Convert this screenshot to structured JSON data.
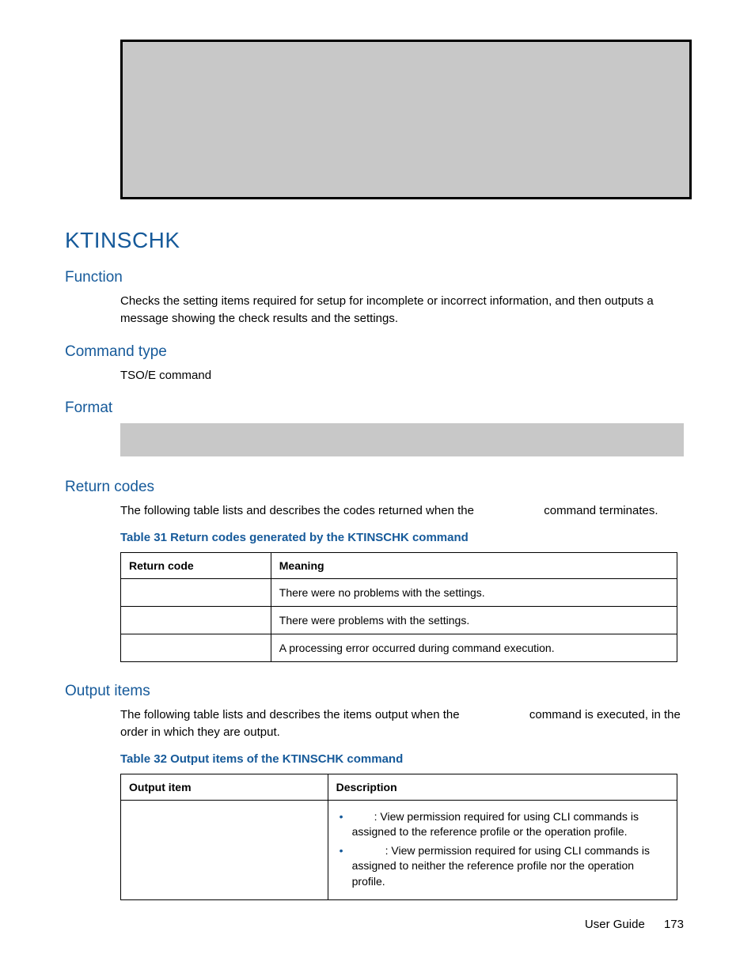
{
  "command_name": "KTINSCHK",
  "sections": {
    "function": {
      "title": "Function",
      "text": "Checks the setting items required for setup for incomplete or incorrect information, and then outputs a message showing the check results and the settings."
    },
    "command_type": {
      "title": "Command type",
      "text": "TSO/E command"
    },
    "format": {
      "title": "Format"
    },
    "return_codes": {
      "title": "Return codes",
      "intro_before": "The following table lists and describes the codes returned when the ",
      "intro_after": " command terminates.",
      "caption": "Table 31 Return codes generated by the KTINSCHK command",
      "headers": [
        "Return code",
        "Meaning"
      ],
      "rows": [
        {
          "code": "",
          "meaning": "There were no problems with the settings."
        },
        {
          "code": "",
          "meaning": "There were problems with the settings."
        },
        {
          "code": "",
          "meaning": "A processing error occurred during command execution."
        }
      ]
    },
    "output_items": {
      "title": "Output items",
      "intro_before": "The following table lists and describes the items output when the ",
      "intro_after": " command is executed, in the order in which they are output.",
      "caption": "Table 32 Output items of the KTINSCHK command",
      "headers": [
        "Output item",
        "Description"
      ],
      "rows": [
        {
          "item": "",
          "bullets": [
            ": View permission required for using CLI commands is assigned to the reference profile or the operation profile.",
            ": View permission required for using CLI commands is assigned to neither the reference profile nor the operation profile."
          ]
        }
      ]
    }
  },
  "footer": {
    "label": "User Guide",
    "page": "173"
  }
}
